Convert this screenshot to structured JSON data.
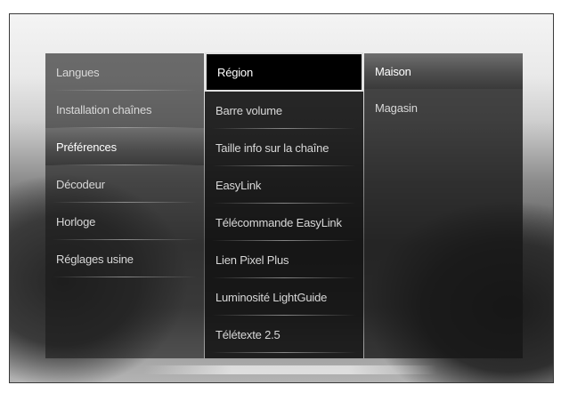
{
  "menu": {
    "level1": [
      "Langues",
      "Installation chaînes",
      "Préférences",
      "Décodeur",
      "Horloge",
      "Réglages usine"
    ],
    "level1_selected": "Préférences",
    "level2": [
      "Région",
      "Barre volume",
      "Taille info sur la chaîne",
      "EasyLink",
      "Télécommande EasyLink",
      "Lien Pixel Plus",
      "Luminosité LightGuide",
      "Télétexte 2.5"
    ],
    "level2_focused": "Région",
    "level3": [
      "Maison",
      "Magasin"
    ],
    "level3_selected": "Maison"
  }
}
